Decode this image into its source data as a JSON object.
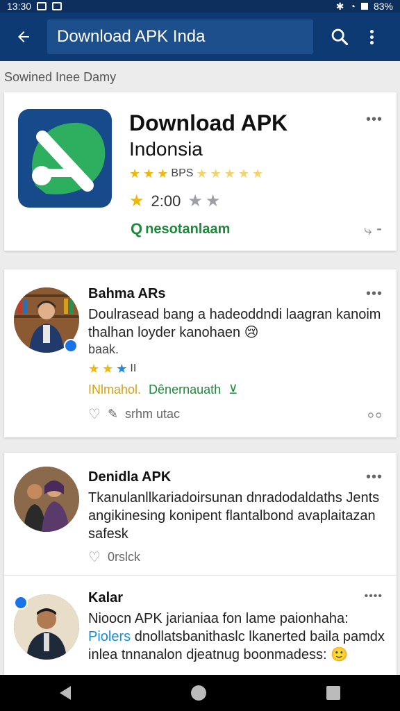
{
  "status": {
    "time": "13:30",
    "battery": "83%"
  },
  "appbar": {
    "search_text": "Download APK Inda"
  },
  "section_label": "Sowined Inee Damy",
  "app": {
    "title_line1": "Download APK",
    "title_line2": "Indonsia",
    "rating_label": "BPS",
    "rating_value": "2:00",
    "publisher": "nesotanlaam",
    "colors": {
      "icon_bg": "#164a8a",
      "leaf": "#2eae5f"
    }
  },
  "reviews": [
    {
      "name": "Bahma ARs",
      "text": "Doulrasead bang a hadeoddndi laagran kanoim thalhan loyder kanohaen 😢",
      "text_more": "baak.",
      "stars_extra": "II",
      "meta_left": "INlmahol.",
      "meta_right": "Dênernauath",
      "action_label": "srhm utac"
    },
    {
      "name": "Denidla APK",
      "text": "Tkanulanllkariadoirsunan dnradodaldaths Jents angikinesing konipent flantalbond avaplaitazan safesk",
      "action_label": "0rslck"
    },
    {
      "name": "Kalar",
      "text_start": "Nioocn APK jarianiaa fon lame paionhaha:",
      "text_blue": "Piolers",
      "text_rest": "dnollatsbanithaslc lkanerted baila pamdx inlea tnnanalon djeatnug boonmadess: 🙂"
    }
  ]
}
